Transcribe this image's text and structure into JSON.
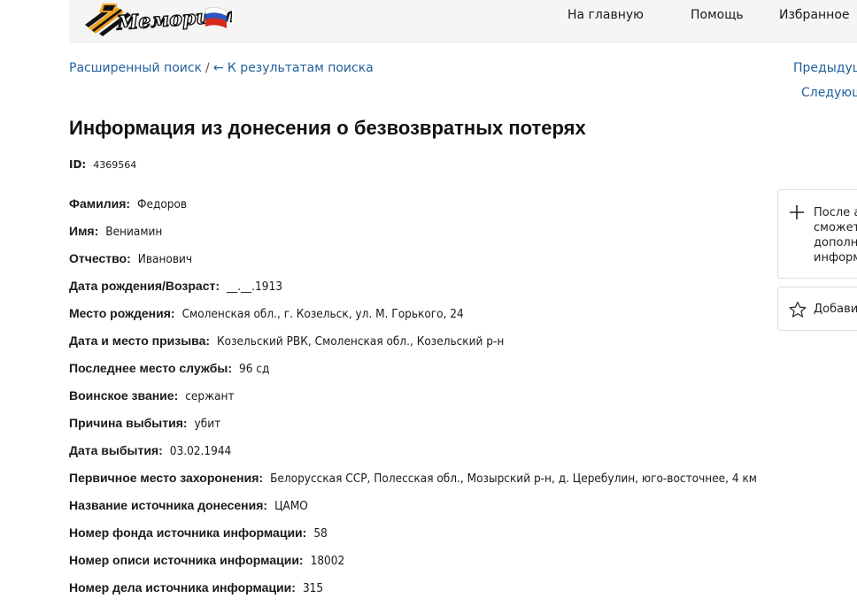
{
  "header": {
    "logo_text": "Мемориал",
    "nav": [
      "На главную",
      "Помощь",
      "Избранное"
    ]
  },
  "breadcrumb": {
    "advanced_search": "Расширенный поиск",
    "separator": "/",
    "back_to_results": "← К результатам поиска"
  },
  "pager": {
    "prev": "Предыдущ",
    "next": "Следующ"
  },
  "page_title": "Информация из донесения о безвозвратных потерях",
  "record_id": {
    "label": "ID:",
    "value": "4369564"
  },
  "fields": [
    {
      "label": "Фамилия:",
      "value": "Федоров"
    },
    {
      "label": "Имя:",
      "value": "Вениамин"
    },
    {
      "label": "Отчество:",
      "value": "Иванович"
    },
    {
      "label": "Дата рождения/Возраст:",
      "value": "__.__.1913"
    },
    {
      "label": "Место рождения:",
      "value": "Смоленская обл., г. Козельск, ул. М. Горького, 24"
    },
    {
      "label": "Дата и место призыва:",
      "value": "Козельский РВК, Смоленская обл., Козельский р-н"
    },
    {
      "label": "Последнее место службы:",
      "value": "96 сд"
    },
    {
      "label": "Воинское звание:",
      "value": "сержант"
    },
    {
      "label": "Причина выбытия:",
      "value": "убит"
    },
    {
      "label": "Дата выбытия:",
      "value": "03.02.1944"
    },
    {
      "label": "Первичное место захоронения:",
      "value": "Белорусская ССР, Полесская обл., Мозырский р-н, д. Церебулин, юго-восточнее, 4 км"
    },
    {
      "label": "Название источника донесения:",
      "value": "ЦАМО"
    },
    {
      "label": "Номер фонда источника информации:",
      "value": "58"
    },
    {
      "label": "Номер описи источника информации:",
      "value": "18002"
    },
    {
      "label": "Номер дела источника информации:",
      "value": "315"
    }
  ],
  "side_cards": {
    "add_info_lines": [
      "После а",
      "сможет",
      "дополн",
      "информ"
    ],
    "favorite": "Добави"
  },
  "colors": {
    "link": "#1f5f9c",
    "header_bg": "#f5f5f5"
  },
  "icons": {
    "add": "plus-icon",
    "favorite": "star-icon"
  }
}
